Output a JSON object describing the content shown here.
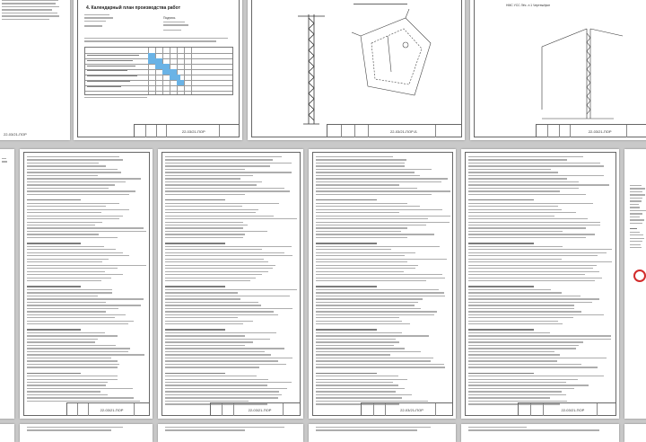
{
  "document": {
    "code": "22-03/21-ПОР",
    "section_title": "4. Календарный план производства работ",
    "bottom_left_code": "22-03/21-ПОР",
    "top_right_label": "НМС УСС Лёс. л.1 Чертеж/фон"
  },
  "pages": [
    {
      "id": "p1",
      "code": "22-03/21-ПОР"
    },
    {
      "id": "p2",
      "code": "22-03/21-ПОР",
      "title": "4. Календарный план производства работ"
    },
    {
      "id": "p3",
      "code": "22-03/21-ПОР-Б"
    },
    {
      "id": "p4",
      "code": "22-03/21-ПОР"
    },
    {
      "id": "p5",
      "code": ""
    },
    {
      "id": "p6",
      "code": "22-03/21-ПОР"
    },
    {
      "id": "p7",
      "code": "22-03/21-ПОР"
    },
    {
      "id": "p8",
      "code": "22-03/21-ПОР"
    },
    {
      "id": "p9",
      "code": "22-03/21-ПОР"
    },
    {
      "id": "p10",
      "code": ""
    }
  ],
  "section_labels": {
    "approved": "Подпись",
    "agreed": "Согласовано"
  },
  "colors": {
    "gantt_bar": "#6ab3e6",
    "background": "#c9c9c9",
    "warning_red": "#d22b2b"
  }
}
